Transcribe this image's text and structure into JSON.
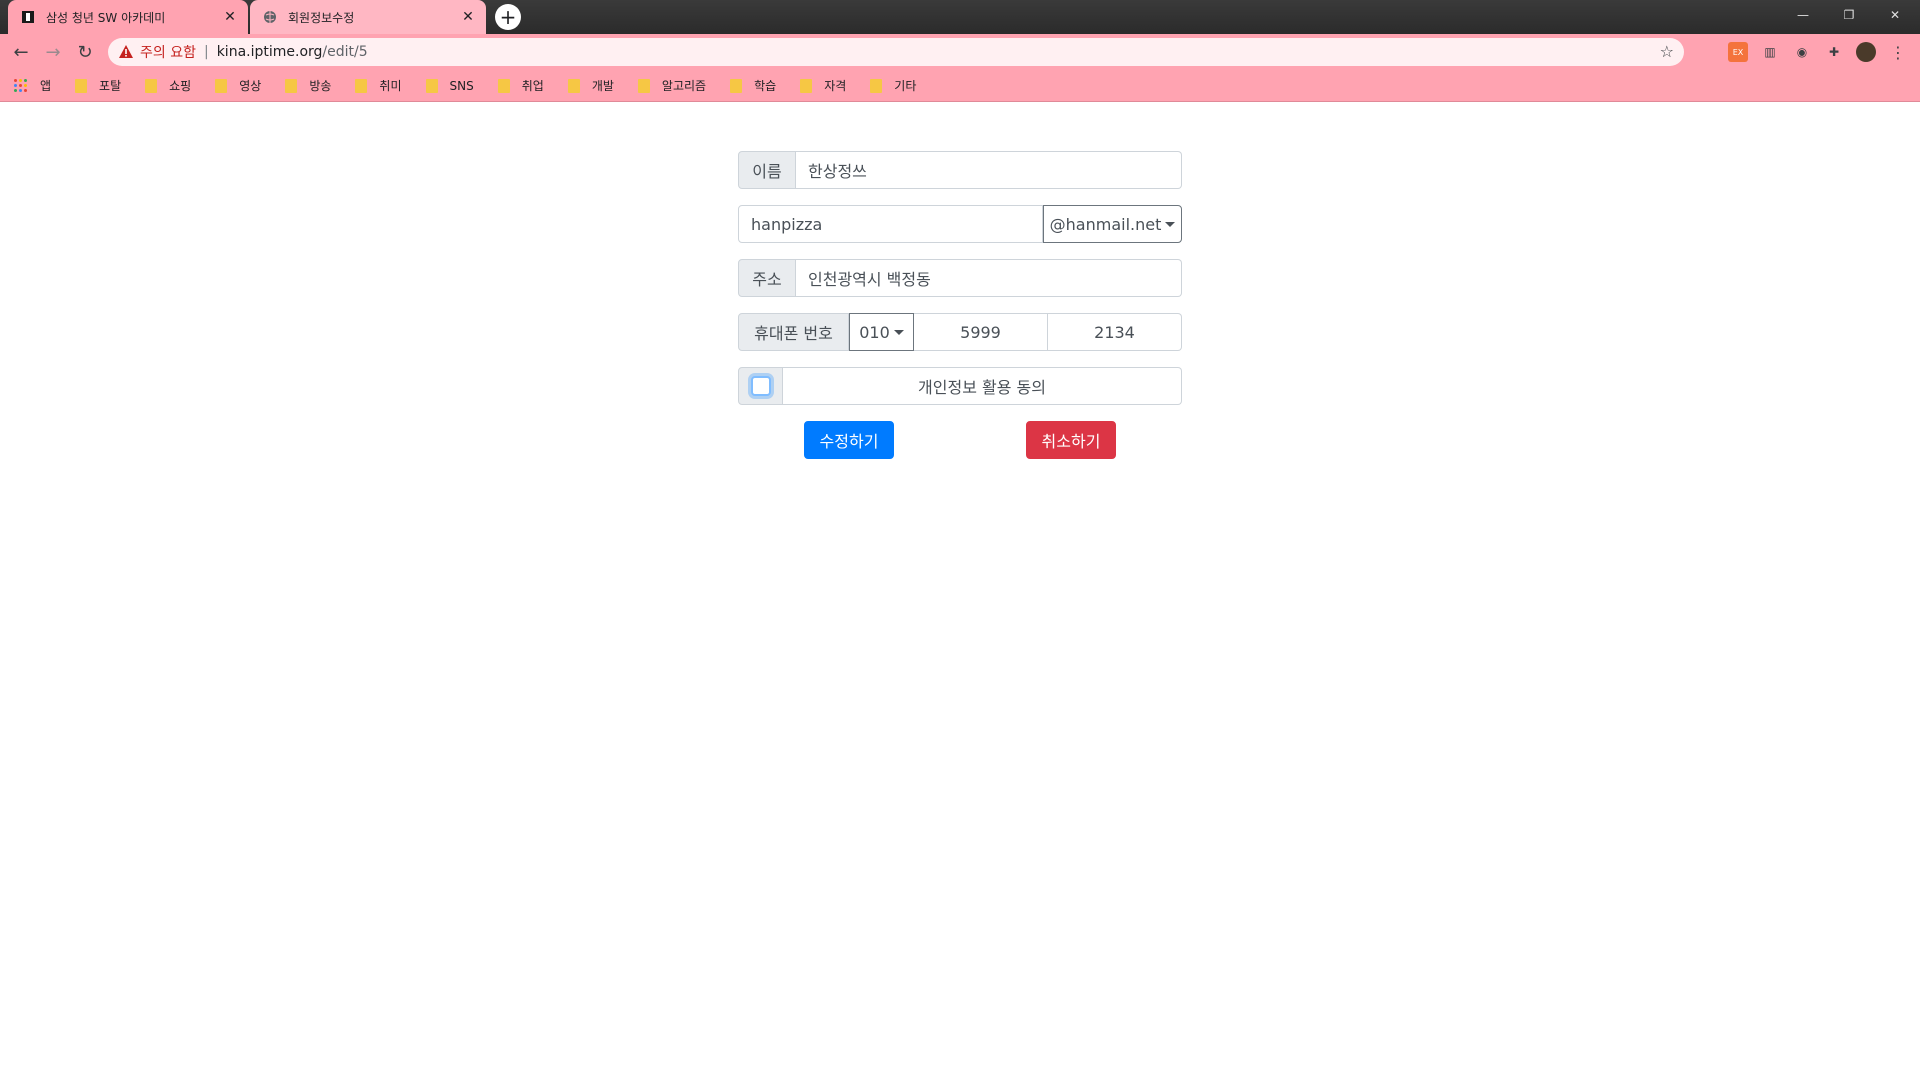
{
  "browser": {
    "tabs": [
      {
        "title": "삼성 청년 SW 아카데미",
        "active": true
      },
      {
        "title": "회원정보수정",
        "active": false
      }
    ],
    "address": {
      "warning": "주의 요함",
      "host": "kina.iptime.org",
      "path": "/edit/5"
    },
    "bookmarks": [
      {
        "label": "앱",
        "type": "apps"
      },
      {
        "label": "포탈",
        "type": "folder"
      },
      {
        "label": "쇼핑",
        "type": "folder"
      },
      {
        "label": "영상",
        "type": "folder"
      },
      {
        "label": "방송",
        "type": "folder"
      },
      {
        "label": "취미",
        "type": "folder"
      },
      {
        "label": "SNS",
        "type": "folder"
      },
      {
        "label": "취업",
        "type": "folder"
      },
      {
        "label": "개발",
        "type": "folder"
      },
      {
        "label": "알고리즘",
        "type": "folder"
      },
      {
        "label": "학습",
        "type": "folder"
      },
      {
        "label": "자격",
        "type": "folder"
      },
      {
        "label": "기타",
        "type": "folder"
      }
    ],
    "colors": {
      "chrome_pink": "#ffa3b1",
      "warning_red": "#c5221f"
    }
  },
  "form": {
    "name": {
      "label": "이름",
      "value": "한상정쓰"
    },
    "email": {
      "local": "hanpizza",
      "domain": "@hanmail.net"
    },
    "address": {
      "label": "주소",
      "value": "인천광역시 백정동"
    },
    "phone": {
      "label": "휴대폰 번호",
      "prefix": "010",
      "middle": "5999",
      "last": "2134"
    },
    "consent": {
      "label": "개인정보 활용 동의",
      "checked": false
    },
    "submit_label": "수정하기",
    "cancel_label": "취소하기"
  }
}
